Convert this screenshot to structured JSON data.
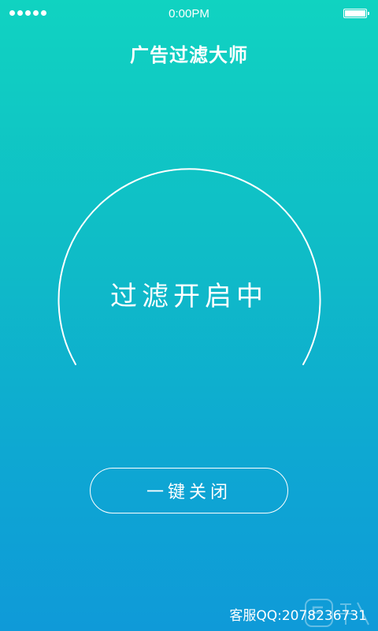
{
  "status_bar": {
    "time": "0:00PM",
    "signal_dots": 5,
    "battery_level": 1.0
  },
  "header": {
    "title": "广告过滤大师"
  },
  "main": {
    "filter_status": "过滤开启中",
    "close_button_label": "一键关闭"
  },
  "footer": {
    "support_label": "客服QQ:",
    "support_number": "2078236731"
  },
  "colors": {
    "gradient_top": "#10d3c1",
    "gradient_bottom": "#0f9ad8",
    "foreground": "#ffffff"
  }
}
